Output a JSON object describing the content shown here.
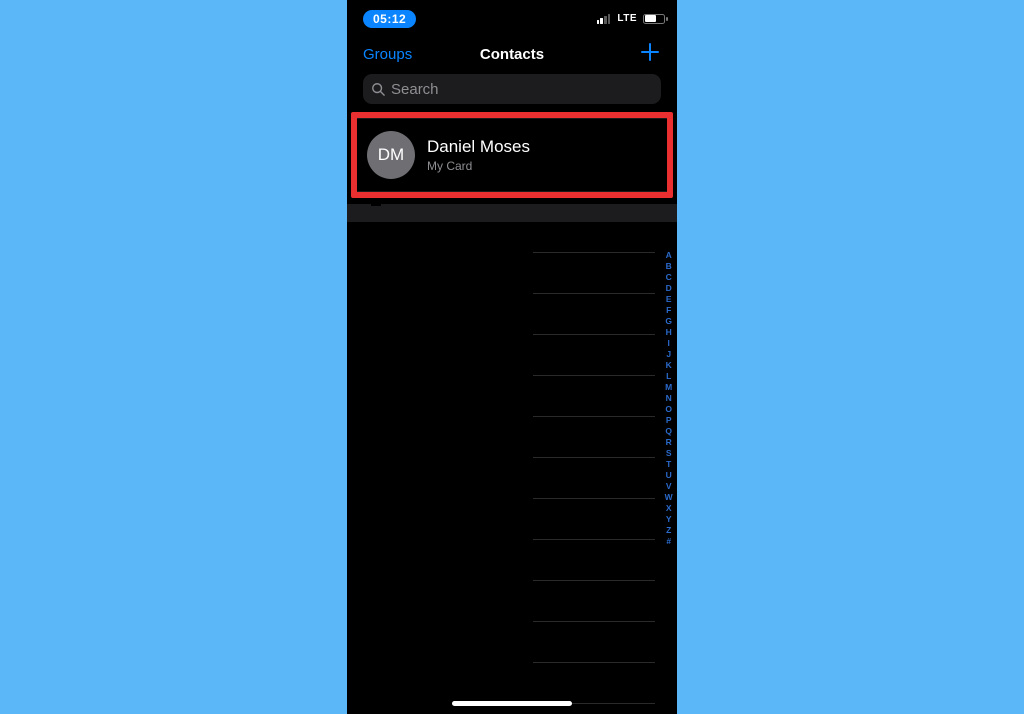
{
  "status_bar": {
    "time": "05:12",
    "network_label": "LTE"
  },
  "nav": {
    "left": "Groups",
    "title": "Contacts"
  },
  "search": {
    "placeholder": "Search"
  },
  "my_card": {
    "initials": "DM",
    "name": "Daniel Moses",
    "subtitle": "My Card"
  },
  "index_letters": [
    "A",
    "B",
    "C",
    "D",
    "E",
    "F",
    "G",
    "H",
    "I",
    "J",
    "K",
    "L",
    "M",
    "N",
    "O",
    "P",
    "Q",
    "R",
    "S",
    "T",
    "U",
    "V",
    "W",
    "X",
    "Y",
    "Z",
    "#"
  ],
  "colors": {
    "accent": "#0a84ff",
    "highlight_border": "#e92f2f"
  }
}
